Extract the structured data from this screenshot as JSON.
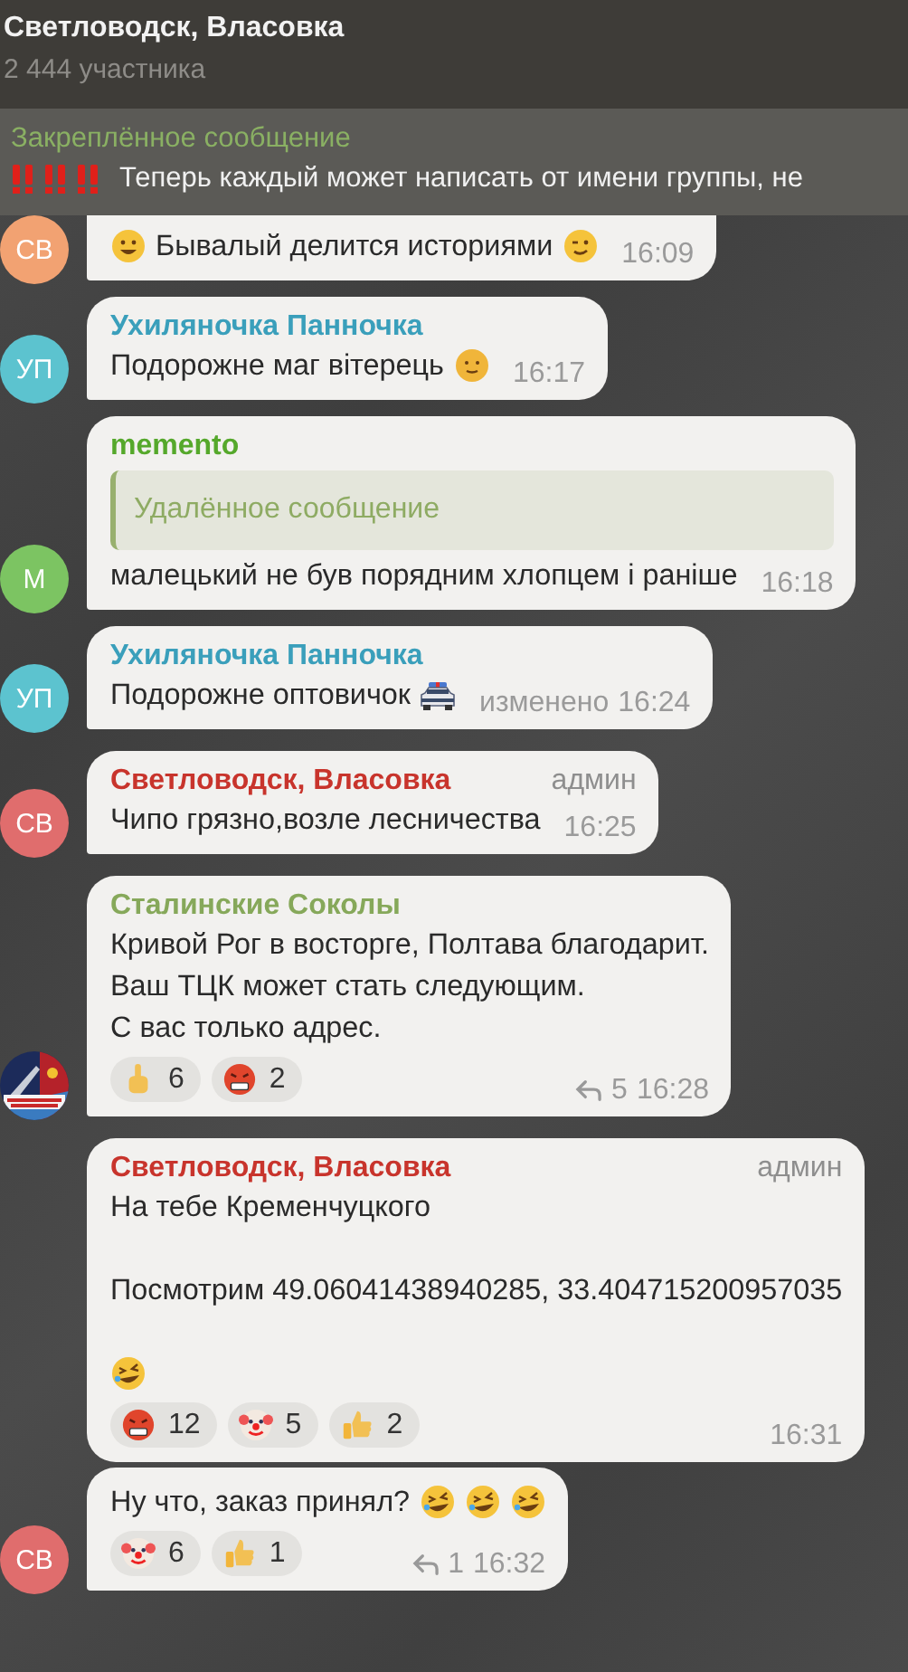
{
  "header": {
    "title": "Светловодск, Власовка",
    "subtitle": "2 444 участника"
  },
  "pinned": {
    "title": "Закреплённое сообщение",
    "marks": [
      {
        "kind": "double_exclamation"
      },
      {
        "kind": "double_exclamation"
      },
      {
        "kind": "double_exclamation"
      }
    ],
    "text": "Теперь каждый может написать от имени группы, не"
  },
  "messages": [
    {
      "avatar": {
        "kind": "initials",
        "text": "СВ",
        "color": "#f2a272"
      },
      "lines": [
        [
          {
            "kind": "grin"
          },
          {
            "kind": "text",
            "text": "Бывалый делится историями"
          },
          {
            "kind": "wink"
          }
        ]
      ],
      "time": "16:09"
    },
    {
      "avatar": {
        "kind": "initials",
        "text": "УП",
        "color": "#5cc3cf"
      },
      "sender": {
        "name": "Ухиляночка Панночка",
        "color": "#3a9fbb"
      },
      "lines": [
        [
          {
            "kind": "text",
            "text": "Подорожне маг вітерець"
          },
          {
            "kind": "sun"
          }
        ]
      ],
      "time": "16:17"
    },
    {
      "avatar": {
        "kind": "initials",
        "text": "М",
        "color": "#7cc462"
      },
      "sender": {
        "name": "memento",
        "color": "#55a82b"
      },
      "quote": "Удалённое сообщение",
      "lines": [
        [
          {
            "kind": "text",
            "text": "малецький не був порядним хлопцем і раніше"
          }
        ]
      ],
      "time": "16:18"
    },
    {
      "avatar": {
        "kind": "initials",
        "text": "УП",
        "color": "#5cc3cf"
      },
      "sender": {
        "name": "Ухиляночка Панночка",
        "color": "#3a9fbb"
      },
      "lines": [
        [
          {
            "kind": "text",
            "text": "Подорожне оптовичок"
          },
          {
            "kind": "police"
          }
        ]
      ],
      "edited": "изменено",
      "time": "16:24"
    },
    {
      "avatar": {
        "kind": "initials",
        "text": "СВ",
        "color": "#e06d6d"
      },
      "sender": {
        "name": "Светловодск, Власовка",
        "color": "#c8342c"
      },
      "badge": "админ",
      "lines": [
        [
          {
            "kind": "text",
            "text": "Чипо грязно,возле лесничества"
          }
        ]
      ],
      "time": "16:25"
    },
    {
      "avatar": {
        "kind": "picture"
      },
      "sender": {
        "name": "Сталинские Соколы",
        "color": "#86a85a"
      },
      "lines": [
        [
          {
            "kind": "text",
            "text": "Кривой Рог в восторге, Полтава благодарит."
          }
        ],
        [
          {
            "kind": "text",
            "text": "Ваш ТЦК может стать следующим."
          }
        ],
        [
          {
            "kind": "text",
            "text": "С вас только адрес."
          }
        ]
      ],
      "reactions": [
        {
          "kind": "hand",
          "count": "6"
        },
        {
          "kind": "angry",
          "count": "2"
        }
      ],
      "replies": "5",
      "time": "16:28"
    },
    {
      "sender": {
        "name": "Светловодск, Власовка",
        "color": "#c8342c"
      },
      "badge": "админ",
      "lines": [
        [
          {
            "kind": "text",
            "text": "На тебе Кременчуцкого"
          }
        ],
        [
          {
            "kind": "blank"
          }
        ],
        [
          {
            "kind": "text",
            "text": "Посмотрим 49.06041438940285, 33.404715200957035"
          }
        ],
        [
          {
            "kind": "blank"
          }
        ],
        [
          {
            "kind": "rofl"
          }
        ]
      ],
      "reactions": [
        {
          "kind": "angry",
          "count": "12"
        },
        {
          "kind": "clown",
          "count": "5"
        },
        {
          "kind": "thumb",
          "count": "2"
        }
      ],
      "time": "16:31"
    },
    {
      "avatar": {
        "kind": "initials",
        "text": "СВ",
        "color": "#e06d6d"
      },
      "lines": [
        [
          {
            "kind": "text",
            "text": "Ну что, заказ принял?"
          },
          {
            "kind": "rofl"
          },
          {
            "kind": "rofl"
          },
          {
            "kind": "rofl"
          }
        ]
      ],
      "reactions": [
        {
          "kind": "clown",
          "count": "6"
        },
        {
          "kind": "thumb",
          "count": "1"
        }
      ],
      "replies": "1",
      "time": "16:32"
    }
  ]
}
